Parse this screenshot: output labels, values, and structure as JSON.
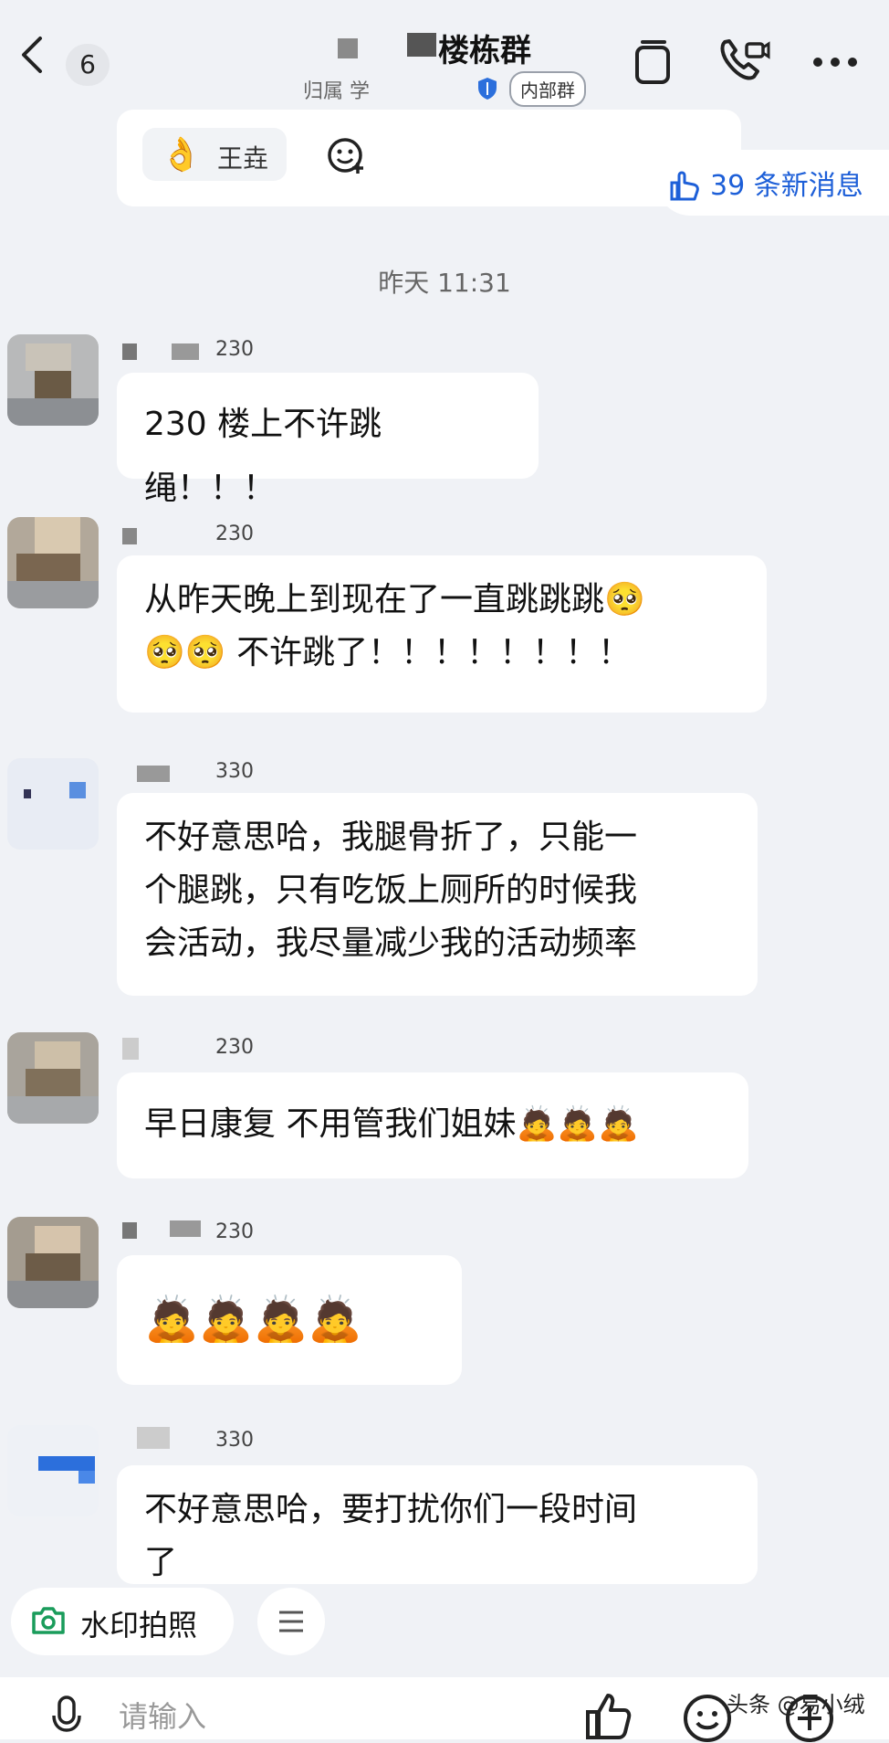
{
  "header": {
    "unread_count": "6",
    "group_title": "楼栋群",
    "group_subtitle": "归属  学",
    "internal_tag": "内部群"
  },
  "reaction": {
    "name": "王垚",
    "new_messages": "39 条新消息"
  },
  "time_separator": "昨天 11:31",
  "messages": [
    {
      "room": "230",
      "text": "230 楼上不许跳绳！！！"
    },
    {
      "room": "230",
      "text": "从昨天晚上到现在了一直跳跳跳🥺\n🥺🥺 不许跳了！！！！！！！！"
    },
    {
      "room": "330",
      "text": "不好意思哈，我腿骨折了，只能一\n个腿跳，只有吃饭上厕所的时候我\n会活动，我尽量减少我的活动频率"
    },
    {
      "room": "230",
      "text": "早日康复 不用管我们姐妹🙇🙇🙇"
    },
    {
      "room": "230",
      "text": "🙇🙇🙇🙇"
    },
    {
      "room": "330",
      "text": "不好意思哈，要打扰你们一段时间\n了"
    }
  ],
  "quick_actions": {
    "watermark_photo": "水印拍照"
  },
  "input": {
    "placeholder": "请输入"
  },
  "credit": "头条 @易小绒",
  "colors": {
    "background": "#f0f2f6",
    "bubble": "#ffffff",
    "accent_blue": "#1d5fd8",
    "green": "#1a9c5b"
  },
  "icons": [
    "back-chevron-icon",
    "copy-icon",
    "phone-video-icon",
    "more-icon",
    "shield-icon",
    "ok-hand-icon",
    "add-emoji-icon",
    "thumb-pointer-icon",
    "camera-icon",
    "menu-icon",
    "microphone-icon",
    "thumbs-up-icon",
    "emoji-icon",
    "plus-icon"
  ]
}
